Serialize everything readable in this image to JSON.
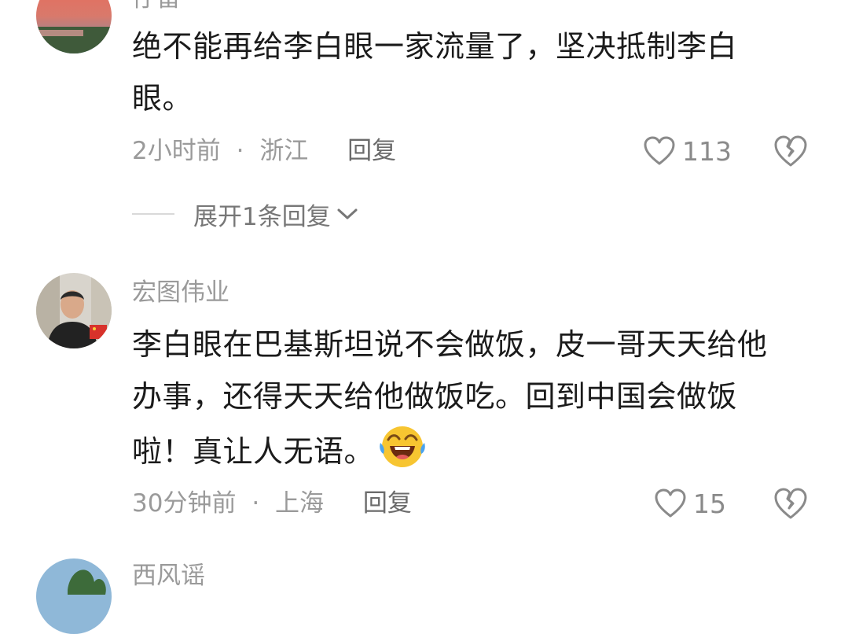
{
  "comments": [
    {
      "username": "仔雷",
      "text_line1": "绝不能再给李白眼一家流量了，坚决抵制李白",
      "text_line2": "眼。",
      "time": "2小时前",
      "separator": "·",
      "location": "浙江",
      "reply_label": "回复",
      "likes": "113",
      "expand_label": "展开1条回复"
    },
    {
      "username": "宏图伟业",
      "text_line1": "李白眼在巴基斯坦说不会做饭，皮一哥天天给他",
      "text_line2": "办事，还得天天给他做饭吃。回到中国会做饭",
      "text_line3": "啦！真让人无语。",
      "emoji": "crying-laughing-emoji",
      "time": "30分钟前",
      "separator": "·",
      "location": "上海",
      "reply_label": "回复",
      "likes": "15"
    },
    {
      "username": "西风谣"
    }
  ],
  "colors": {
    "meta_gray": "#9a9a9a",
    "text": "#1b1b1b",
    "icon_gray": "#8a8a8a"
  },
  "icons": {
    "like": "heart-outline-icon",
    "dislike": "broken-heart-icon",
    "expand": "chevron-down-icon"
  }
}
